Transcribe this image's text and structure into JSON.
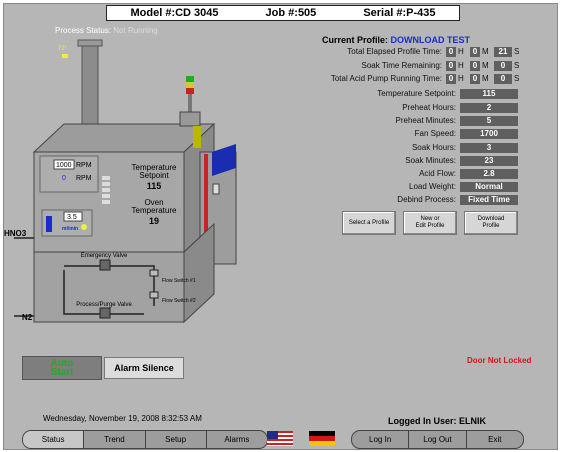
{
  "header": {
    "model": "Model #:CD 3045",
    "job": "Job #:505",
    "serial": "Serial #:P-435"
  },
  "process_status": {
    "label": "Process Status:",
    "value": "Not Running"
  },
  "machine": {
    "stack_value": "72°",
    "rpm1": "1000",
    "rpm_unit1": "RPM",
    "rpm2": "0",
    "rpm_unit2": "RPM",
    "temp_setpoint_label_1": "Temperature",
    "temp_setpoint_label_2": "Setpoint",
    "temp_setpoint": "115",
    "oven_label_1": "Oven",
    "oven_label_2": "Temperature",
    "oven_temp": "19",
    "flow_value": "3.5",
    "flow_unit": "ml/min",
    "hno3": "HNO3",
    "n2": "N2",
    "emergency_valve": "Emergency Valve",
    "purge_valve": "Process/Purge Valve",
    "flow_switch_1": "Flow Switch #1",
    "flow_switch_2": "Flow Switch #2"
  },
  "profile": {
    "current_label": "Current Profile:",
    "current_value": "DOWNLOAD TEST",
    "timers": [
      {
        "label": "Total Elapsed Profile Time:",
        "h": "0",
        "m": "0",
        "s": "21"
      },
      {
        "label": "Soak Time Remaining:",
        "h": "0",
        "m": "0",
        "s": "0"
      },
      {
        "label": "Total Acid Pump Running Time:",
        "h": "0",
        "m": "0",
        "s": "0"
      }
    ],
    "units": {
      "h": "H",
      "m": "M",
      "s": "S"
    },
    "settings": [
      {
        "label": "Temperature Setpoint:",
        "value": "115"
      },
      {
        "label": "Preheat Hours:",
        "value": "2"
      },
      {
        "label": "Preheat Minutes:",
        "value": "5"
      },
      {
        "label": "Fan Speed:",
        "value": "1700"
      },
      {
        "label": "Soak Hours:",
        "value": "3"
      },
      {
        "label": "Soak Minutes:",
        "value": "23"
      },
      {
        "label": "Acid Flow:",
        "value": "2.8"
      },
      {
        "label": "Load Weight:",
        "value": "Normal"
      },
      {
        "label": "Debind Process:",
        "value": "Fixed Time"
      }
    ],
    "buttons": {
      "select": "Select a Profile",
      "new_line1": "New or",
      "new_line2": "Edit Profile",
      "download_line1": "Download",
      "download_line2": "Profile"
    }
  },
  "controls": {
    "auto_line1": "Auto",
    "auto_line2": "Start",
    "alarm_silence": "Alarm Silence",
    "door_status": "Door Not Locked"
  },
  "footer": {
    "datetime": "Wednesday, November 19, 2008   8:32:53 AM",
    "logged_in": "Logged In User: ELNIK",
    "nav_left": [
      "Status",
      "Trend",
      "Setup",
      "Alarms"
    ],
    "nav_right": [
      "Log In",
      "Log Out",
      "Exit"
    ]
  },
  "colors": {
    "accent_blue": "#1a2ccc",
    "alarm_red": "#d01818",
    "auto_green": "#1eaa2a",
    "panel_gray": "#b6b6b6"
  }
}
